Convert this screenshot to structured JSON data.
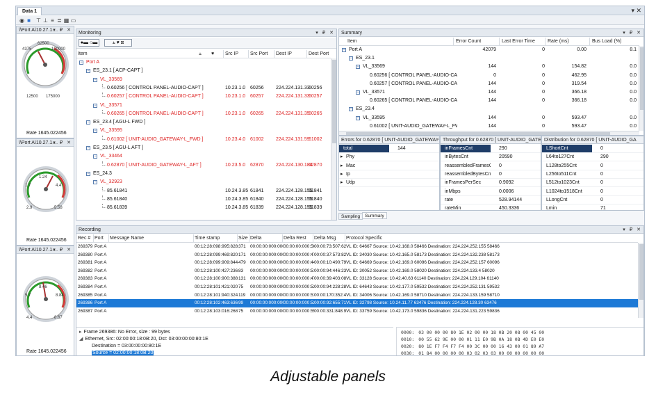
{
  "window": {
    "tab": "Data 1"
  },
  "gauges": [
    {
      "title": "\\\\Port A\\10.27.1....",
      "scale_left": [
        "6250",
        "4375",
        "2500",
        "6250",
        "12500"
      ],
      "scale_right": [
        "62500",
        "81250",
        "100000",
        "118750",
        "137500",
        "175000"
      ],
      "rate": "Rate  1645.022456"
    },
    {
      "title": "\\\\Port A\\10.27.1....",
      "scale_left": [
        "-0.7",
        "1.7",
        "2.9"
      ],
      "scale_right": [
        "1.24",
        "3.34",
        "4.4",
        "4.9",
        "5.58"
      ],
      "rate": "Rate  1645.022456"
    },
    {
      "title": "\\\\Port A\\10.27.1....",
      "scale_left": [
        "5.7",
        "4.8",
        "5.12",
        "4.4"
      ],
      "scale_right": [
        "8.57",
        "8.46",
        "8.67",
        "8.84"
      ],
      "rate": "Rate  1645.022456"
    }
  ],
  "monitoring": {
    "title": "Monitoring",
    "columns": [
      "Item",
      "Src IP",
      "Src Port",
      "Dest IP",
      "Dest Port"
    ],
    "rows": [
      {
        "item": "Port A",
        "src_ip": "",
        "src_port": "",
        "dest_ip": "",
        "dest_port": "",
        "red": true,
        "level": 0,
        "expand": true
      },
      {
        "item": "ES_23.1 [ ACP-CAPT ]",
        "src_ip": "",
        "src_port": "",
        "dest_ip": "",
        "dest_port": "",
        "red": false,
        "level": 1,
        "expand": true
      },
      {
        "item": "VL_33569",
        "src_ip": "",
        "src_port": "",
        "dest_ip": "",
        "dest_port": "",
        "red": true,
        "level": 2,
        "expand": true
      },
      {
        "item": "0.60256 [ CONTROL PANEL-AUDIO-CAPT ]",
        "src_ip": "10.23.1.0",
        "src_port": "60256",
        "dest_ip": "224.224.131.33",
        "dest_port": "60256",
        "red": false,
        "level": 3,
        "expand": false
      },
      {
        "item": "0.60257 [ CONTROL PANEL-AUDIO-CAPT ]",
        "src_ip": "10.23.1.0",
        "src_port": "60257",
        "dest_ip": "224.224.131.33",
        "dest_port": "60257",
        "red": true,
        "level": 3,
        "expand": false
      },
      {
        "item": "VL_33571",
        "src_ip": "",
        "src_port": "",
        "dest_ip": "",
        "dest_port": "",
        "red": true,
        "level": 2,
        "expand": true
      },
      {
        "item": "0.60265 [ CONTROL PANEL-AUDIO-CAPT ]",
        "src_ip": "10.23.1.0",
        "src_port": "60265",
        "dest_ip": "224.224.131.35",
        "dest_port": "60265",
        "red": true,
        "level": 3,
        "expand": false
      },
      {
        "item": "ES_23.4 [ AGU-L FWD ]",
        "src_ip": "",
        "src_port": "",
        "dest_ip": "",
        "dest_port": "",
        "red": false,
        "level": 1,
        "expand": true
      },
      {
        "item": "VL_33595",
        "src_ip": "",
        "src_port": "",
        "dest_ip": "",
        "dest_port": "",
        "red": true,
        "level": 2,
        "expand": true
      },
      {
        "item": "0.61002 [ UNIT-AUDIO_GATEWAY-L_FWD ]",
        "src_ip": "10.23.4.0",
        "src_port": "61002",
        "dest_ip": "224.224.131.59",
        "dest_port": "61002",
        "red": true,
        "level": 3,
        "expand": false
      },
      {
        "item": "ES_23.5 [ AGU-L AFT ]",
        "src_ip": "",
        "src_port": "",
        "dest_ip": "",
        "dest_port": "",
        "red": false,
        "level": 1,
        "expand": true
      },
      {
        "item": "VL_33464",
        "src_ip": "",
        "src_port": "",
        "dest_ip": "",
        "dest_port": "",
        "red": true,
        "level": 2,
        "expand": true
      },
      {
        "item": "0.62870 [ UNIT-AUDIO_GATEWAY-L_AFT ]",
        "src_ip": "10.23.5.0",
        "src_port": "62870",
        "dest_ip": "224.224.130.184",
        "dest_port": "62870",
        "red": true,
        "level": 3,
        "expand": false
      },
      {
        "item": "ES_24.3",
        "src_ip": "",
        "src_port": "",
        "dest_ip": "",
        "dest_port": "",
        "red": false,
        "level": 1,
        "expand": true
      },
      {
        "item": "VL_32923",
        "src_ip": "",
        "src_port": "",
        "dest_ip": "",
        "dest_port": "",
        "red": true,
        "level": 2,
        "expand": true
      },
      {
        "item": "85.61841",
        "src_ip": "10.24.3.85",
        "src_port": "61841",
        "dest_ip": "224.224.128.155",
        "dest_port": "61841",
        "red": false,
        "level": 3,
        "expand": false
      },
      {
        "item": "85.61840",
        "src_ip": "10.24.3.85",
        "src_port": "61840",
        "dest_ip": "224.224.128.155",
        "dest_port": "61840",
        "red": false,
        "level": 3,
        "expand": false
      },
      {
        "item": "85.61839",
        "src_ip": "10.24.3.85",
        "src_port": "61839",
        "dest_ip": "224.224.128.155",
        "dest_port": "61839",
        "red": false,
        "level": 3,
        "expand": false
      }
    ]
  },
  "summary": {
    "title": "Summary",
    "columns": [
      "Item",
      "Error Count",
      "Last Error Time",
      "Rate (ms)",
      "Bus Load (%)"
    ],
    "rows": [
      {
        "item": "Port A",
        "errors": "42079",
        "last": "0",
        "rate": "0.00",
        "load": "8.1",
        "level": 0
      },
      {
        "item": "ES_23.1",
        "errors": "",
        "last": "",
        "rate": "",
        "load": "",
        "level": 1
      },
      {
        "item": "VL_33569",
        "errors": "144",
        "last": "0",
        "rate": "154.82",
        "load": "0.0",
        "level": 2
      },
      {
        "item": "0.60256 [ CONTROL PANEL-AUDIO-CAPT ]",
        "errors": "0",
        "last": "0",
        "rate": "462.95",
        "load": "0.0",
        "level": 3
      },
      {
        "item": "0.60257 [ CONTROL PANEL-AUDIO-CAPT ]",
        "errors": "144",
        "last": "0",
        "rate": "319.54",
        "load": "0.0",
        "level": 3
      },
      {
        "item": "VL_33571",
        "errors": "144",
        "last": "0",
        "rate": "366.18",
        "load": "0.0",
        "level": 2
      },
      {
        "item": "0.60265 [ CONTROL PANEL-AUDIO-CAPT ]",
        "errors": "144",
        "last": "0",
        "rate": "366.18",
        "load": "0.0",
        "level": 3
      },
      {
        "item": "ES_23.4",
        "errors": "",
        "last": "",
        "rate": "",
        "load": "",
        "level": 1
      },
      {
        "item": "VL_33595",
        "errors": "144",
        "last": "0",
        "rate": "593.47",
        "load": "0.0",
        "level": 2
      },
      {
        "item": "0.61002 [ UNIT-AUDIO_GATEWAY-L_FWD ]",
        "errors": "144",
        "last": "0",
        "rate": "593.47",
        "load": "0.0",
        "level": 3
      }
    ]
  },
  "errors_panel": {
    "title": "Errors for 0.62870 [ UNIT-AUDIO_GATEWAY-L_A",
    "rows": [
      {
        "name": "total",
        "value": "144"
      },
      {
        "name": "Phy",
        "value": ""
      },
      {
        "name": "Mac",
        "value": ""
      },
      {
        "name": "Ip",
        "value": ""
      },
      {
        "name": "Udp",
        "value": ""
      }
    ]
  },
  "throughput_panel": {
    "title": "Throughput for 0.62870 [ UNIT-AUDIO_GATEWA",
    "rows": [
      {
        "name": "inFramesCnt",
        "value": "290"
      },
      {
        "name": "inBytesCnt",
        "value": "20590"
      },
      {
        "name": "reassembledFramesCnt",
        "value": "0"
      },
      {
        "name": "reassembledBytesCnt",
        "value": "0"
      },
      {
        "name": "inFramesPerSec",
        "value": "0.9092"
      },
      {
        "name": "inMbps",
        "value": "0.0006"
      },
      {
        "name": "rate",
        "value": "528.94144"
      },
      {
        "name": "rateMin",
        "value": "450.3336"
      }
    ]
  },
  "distribution_panel": {
    "title": "Distribution for 0.62870 [ UNIT-AUDIO_GA",
    "rows": [
      {
        "name": "LShortCnt",
        "value": "0"
      },
      {
        "name": "L64to127Cnt",
        "value": "290"
      },
      {
        "name": "L128to255Cnt",
        "value": "0"
      },
      {
        "name": "L256to511Cnt",
        "value": "0"
      },
      {
        "name": "L512to1023Cnt",
        "value": "0"
      },
      {
        "name": "L1024to1518Cnt",
        "value": "0"
      },
      {
        "name": "LLongCnt",
        "value": "0"
      },
      {
        "name": "Lmin",
        "value": "71"
      }
    ]
  },
  "summary_tabs": [
    "Sampling",
    "Summary"
  ],
  "recording": {
    "title": "Recording",
    "columns": [
      "Rec #",
      "Port",
      "Message Name",
      "Time stamp",
      "Size",
      "Delta",
      "Delta Rest",
      "Delta Msg",
      "Protocol Specific"
    ],
    "rows": [
      {
        "rec": "269379",
        "port": "Port A",
        "ts": "00:12:28:098:995:828",
        "size": "371",
        "delta": "00:00:00:000:000",
        "drest": "00:00:00:000:566:432",
        "dmsg": "00:00:73:507:624",
        "proto": "VL ID: 64667   Source: 10.42.168.0      58466      Destination: 224.224.252.155  58466"
      },
      {
        "rec": "269380",
        "port": "Port A",
        "ts": "00:12:28:099:469:820",
        "size": "171",
        "delta": "00:00:00:000:000",
        "drest": "00:00:00:000:473:992",
        "dmsg": "00:00:37:573:824",
        "proto": "VL ID: 34030   Source: 10.42.165.0      58173      Destination: 224.224.132.238  58173"
      },
      {
        "rec": "269381",
        "port": "Port A",
        "ts": "00:12:28:099:909:844",
        "size": "479",
        "delta": "00:00:00:000:000",
        "drest": "00:00:00:000:440:024",
        "dmsg": "00:00:10:490:792",
        "proto": "VL ID: 64669   Source: 10.42.169.0      60096      Destination: 224.224.252.157  60096"
      },
      {
        "rec": "269382",
        "port": "Port A",
        "ts": "00:12:28:100:427:236",
        "size": "83",
        "delta": "00:00:00:000:000",
        "drest": "00:00:00:000:517:392",
        "dmsg": "00:00:94:446:232",
        "proto": "VL ID: 30052   Source: 10.42.169.0      58020      Destination: 224.224.133.4    58020"
      },
      {
        "rec": "269383",
        "port": "Port A",
        "ts": "00:12:28:100:900:388",
        "size": "131",
        "delta": "00:00:00:000:000",
        "drest": "00:00:00:000:473:152",
        "dmsg": "00:00:39:403:080",
        "proto": "VL ID: 33128   Source: 10.42.40.63      61140      Destination: 224.224.129.104  61140"
      },
      {
        "rec": "269384",
        "port": "Port A",
        "ts": "00:12:28:101:421:020",
        "size": "75",
        "delta": "00:00:00:000:000",
        "drest": "00:00:00:000:520:632",
        "dmsg": "00:00:94:228:280",
        "proto": "VL ID: 64643   Source: 10.42.177.0      59532      Destination: 224.224.252.131  59532"
      },
      {
        "rec": "269385",
        "port": "Port A",
        "ts": "00:12:28:101:940:324",
        "size": "119",
        "delta": "00:00:00:000:000",
        "drest": "00:00:00:000:519:304",
        "dmsg": "00:00:170:352:480",
        "proto": "VL ID: 34006   Source: 10.42.169.0      58710      Destination: 224.224.133.159  58710"
      },
      {
        "rec": "269386",
        "port": "Port A",
        "ts": "00:12:28:102:463:636",
        "size": "99",
        "delta": "00:00:00:000:000",
        "drest": "00:00:00:000:523:312",
        "dmsg": "00:00:92:655:712",
        "proto": "VL ID: 32798   Source: 10.24.11.77      63476      Destination: 224.224.128.30   63476",
        "selected": true
      },
      {
        "rec": "269387",
        "port": "Port A",
        "ts": "00:12:28:103:016:268",
        "size": "75",
        "delta": "00:00:00:000:000",
        "drest": "00:00:00:000:552:632",
        "dmsg": "00:00:331:848:984",
        "proto": "VL ID: 33759   Source: 10.42.173.0      59836      Destination: 224.224.131.223  59836"
      }
    ],
    "detail": [
      {
        "text": "Frame 269386: No Error, size : 99 bytes",
        "indent": 0,
        "arrow": "▸"
      },
      {
        "text": "Ethernet, Src: 02:00:00:18:0B:20, Dst: 03:00:00:00:80:1E",
        "indent": 0,
        "arrow": "◢"
      },
      {
        "text": "Destination = 03:00:00:00:80:1E",
        "indent": 1,
        "arrow": ""
      },
      {
        "text": "Source = 02:00:00:18:0B:20",
        "indent": 1,
        "arrow": "",
        "selected": true
      }
    ],
    "hex": [
      {
        "offset": "0000:",
        "bytes": "03 00 00 00 80 1E 02 00 00 18 0B 20 08 00 45 00"
      },
      {
        "offset": "0010:",
        "bytes": "00 55 62 9E 00 00 01 11 E0 9B 0A 18 0B 4D E0 E0"
      },
      {
        "offset": "0020:",
        "bytes": "80 1E F7 F4 F7 F4 00 3C 00 00 16 43 00 01 89 A7"
      },
      {
        "offset": "0030:",
        "bytes": "01 84 00 00 00 00 03 02 03 03 00 00 00 00 00 00"
      }
    ]
  },
  "caption": "Adjustable panels"
}
